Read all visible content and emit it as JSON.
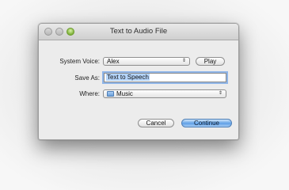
{
  "window": {
    "title": "Text to Audio File",
    "traffic_lights": [
      "close",
      "minimize",
      "zoom"
    ]
  },
  "form": {
    "system_voice": {
      "label": "System Voice:",
      "value": "Alex",
      "arrows": "⇕"
    },
    "play_label": "Play",
    "save_as": {
      "label": "Save As:",
      "value": "Text to Speech"
    },
    "where": {
      "label": "Where:",
      "value": "Music",
      "icon": "folder-icon",
      "arrows": "⇕"
    }
  },
  "buttons": {
    "cancel": "Cancel",
    "continue": "Continue"
  },
  "colors": {
    "default_button": "#6aa7e8",
    "focus_ring": "#8fb5e8",
    "selection": "#b5d5fb"
  }
}
